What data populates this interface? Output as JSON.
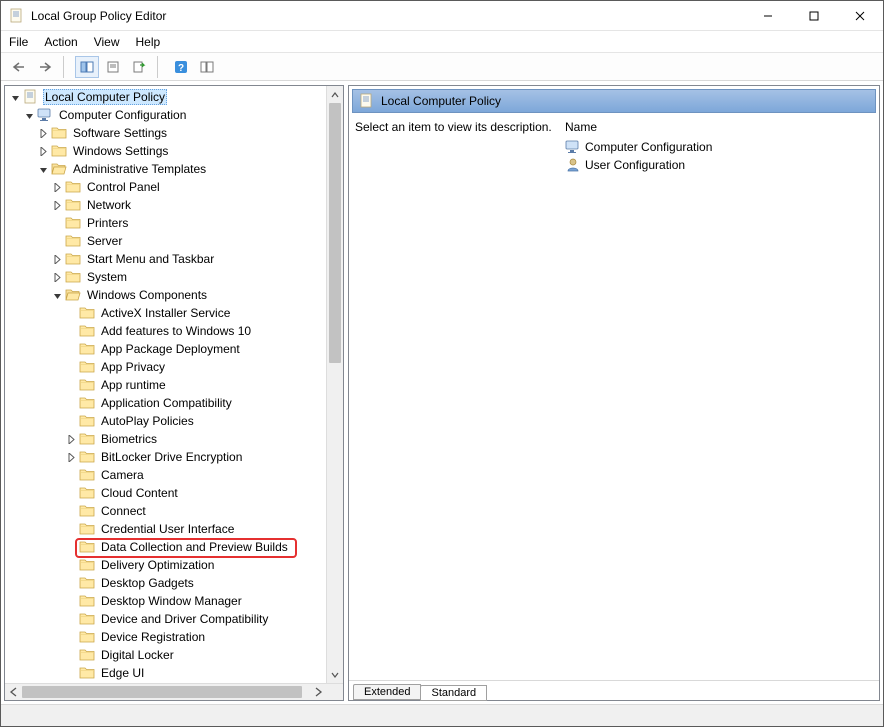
{
  "window": {
    "title": "Local Group Policy Editor"
  },
  "menus": {
    "file": "File",
    "action": "Action",
    "view": "View",
    "help": "Help"
  },
  "tree": {
    "root": {
      "label": "Local Computer Policy"
    },
    "cc": {
      "label": "Computer Configuration"
    },
    "ss": {
      "label": "Software Settings"
    },
    "ws": {
      "label": "Windows Settings"
    },
    "at": {
      "label": "Administrative Templates"
    },
    "cp": {
      "label": "Control Panel"
    },
    "net": {
      "label": "Network"
    },
    "prn": {
      "label": "Printers"
    },
    "srv": {
      "label": "Server"
    },
    "smtb": {
      "label": "Start Menu and Taskbar"
    },
    "sys": {
      "label": "System"
    },
    "wc": {
      "label": "Windows Components"
    },
    "axi": {
      "label": "ActiveX Installer Service"
    },
    "aftw": {
      "label": "Add features to Windows 10"
    },
    "apd": {
      "label": "App Package Deployment"
    },
    "apriv": {
      "label": "App Privacy"
    },
    "aprt": {
      "label": "App runtime"
    },
    "acomp": {
      "label": "Application Compatibility"
    },
    "apol": {
      "label": "AutoPlay Policies"
    },
    "bio": {
      "label": "Biometrics"
    },
    "bl": {
      "label": "BitLocker Drive Encryption"
    },
    "cam": {
      "label": "Camera"
    },
    "cloud": {
      "label": "Cloud Content"
    },
    "conn": {
      "label": "Connect"
    },
    "cui": {
      "label": "Credential User Interface"
    },
    "dcpb": {
      "label": "Data Collection and Preview Builds"
    },
    "dopt": {
      "label": "Delivery Optimization"
    },
    "dg": {
      "label": "Desktop Gadgets"
    },
    "dwm": {
      "label": "Desktop Window Manager"
    },
    "ddc": {
      "label": "Device and Driver Compatibility"
    },
    "dreg": {
      "label": "Device Registration"
    },
    "dlock": {
      "label": "Digital Locker"
    },
    "edge": {
      "label": "Edge UI"
    }
  },
  "right": {
    "header": "Local Computer Policy",
    "desc": "Select an item to view its description.",
    "name_col": "Name",
    "items": {
      "cc": "Computer Configuration",
      "uc": "User Configuration"
    }
  },
  "tabs": {
    "extended": "Extended",
    "standard": "Standard"
  }
}
